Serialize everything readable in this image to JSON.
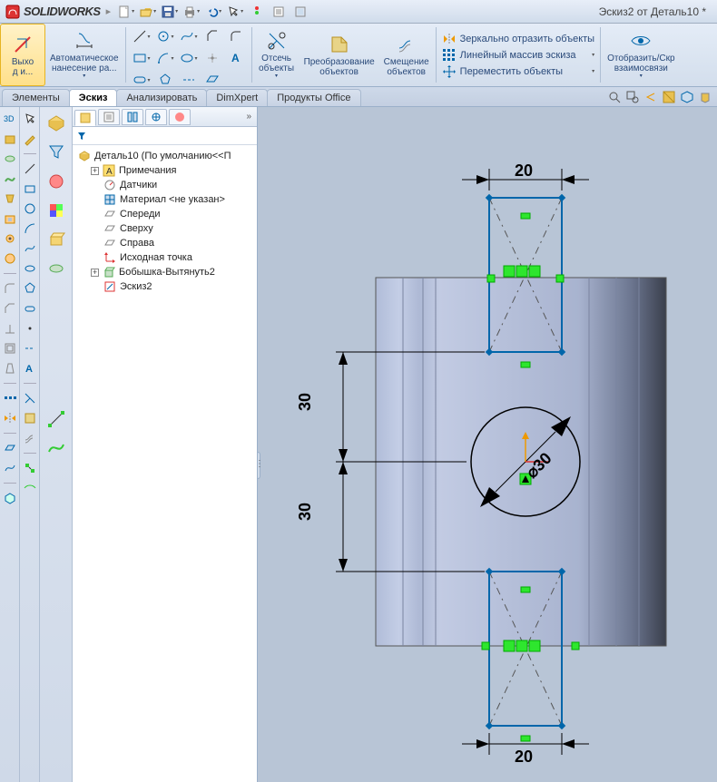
{
  "title": {
    "app": "SOLIDWORKS",
    "doc": "Эскиз2 от Деталь10 *"
  },
  "qat": {
    "new": "new-icon",
    "open": "open-icon",
    "save": "save-icon",
    "print": "print-icon",
    "undo": "undo-icon",
    "select": "select-icon",
    "rebuild": "rebuild-icon",
    "options": "options-icon",
    "capture": "capture-icon"
  },
  "ribbon": {
    "exit_label": "Выхо\nд и...",
    "smart_dim_label": "Автоматическое\nнанесение ра...",
    "trim_label": "Отсечь\nобъекты",
    "convert_label": "Преобразование\nобъектов",
    "offset_label": "Смещение\nобъектов",
    "mirror_label": "Зеркально отразить объекты",
    "linear_pattern_label": "Линейный массив эскиза",
    "move_label": "Переместить объекты",
    "display_label": "Отобразить/Скр\nвзаимосвязи"
  },
  "tabs": {
    "elements": "Элементы",
    "sketch": "Эскиз",
    "analyze": "Анализировать",
    "dimxpert": "DimXpert",
    "office": "Продукты Office"
  },
  "fm": {
    "root": "Деталь10  (По умолчанию<<П",
    "annotations": "Примечания",
    "sensors": "Датчики",
    "material": "Материал <не указан>",
    "front": "Спереди",
    "top": "Сверху",
    "right": "Справа",
    "origin": "Исходная точка",
    "extrude": "Бобышка-Вытянуть2",
    "sketch2": "Эскиз2"
  },
  "dims": {
    "top_width": "20",
    "bottom_width": "20",
    "upper_30": "30",
    "lower_30": "30",
    "dia": "⌀30"
  },
  "colors": {
    "construction": "#000",
    "relation": "#00a000",
    "relation_fill": "#2ee62e",
    "extent": "#555",
    "body_fill": "#b7c3e8"
  }
}
